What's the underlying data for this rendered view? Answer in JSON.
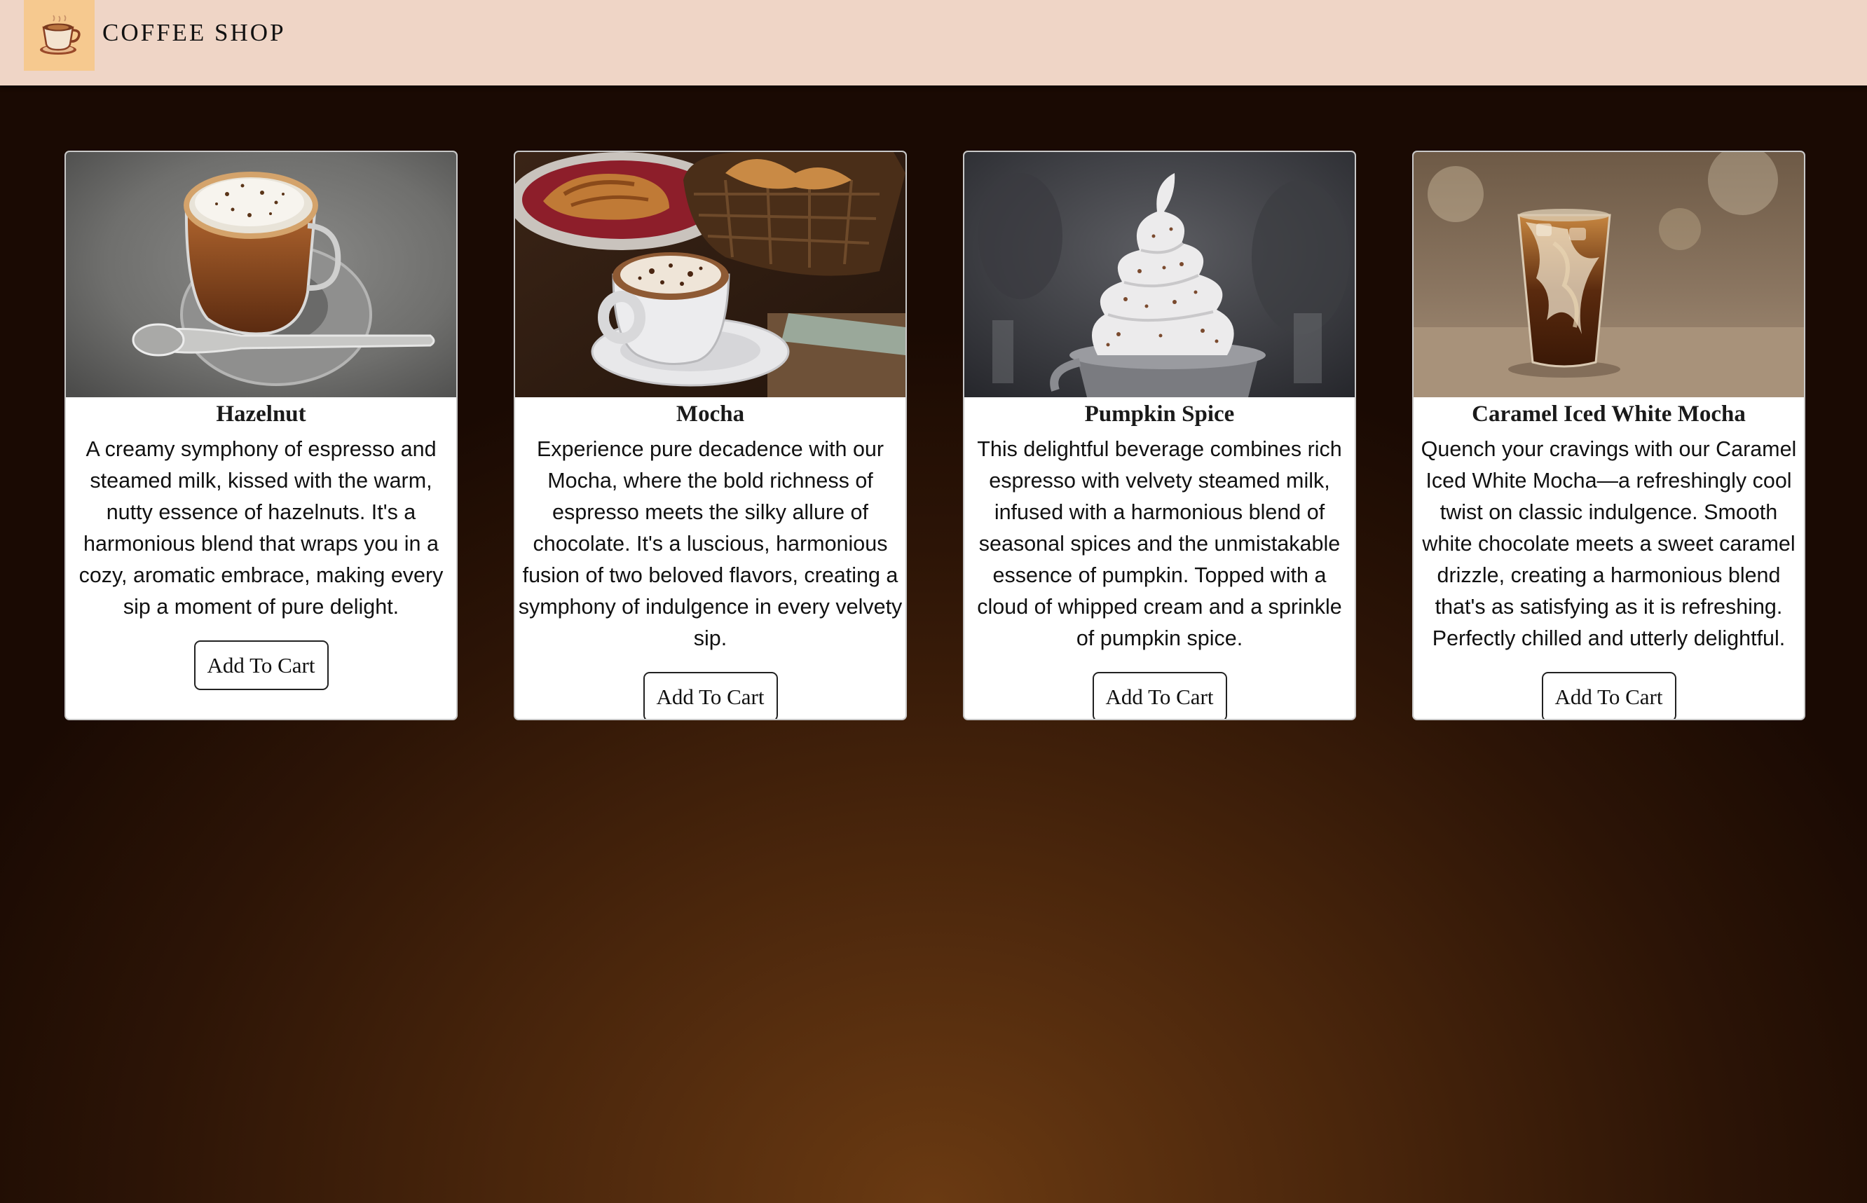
{
  "header": {
    "brand": "COFFEE SHOP",
    "logo_icon": "coffee-cup-icon",
    "background": "#efd5c6"
  },
  "products": [
    {
      "name": "Hazelnut",
      "description": "A creamy symphony of espresso and steamed milk, kissed with the warm, nutty essence of hazelnuts. It's a harmonious blend that wraps you in a cozy, aromatic embrace, making every sip a moment of pure delight.",
      "button_label": "Add To Cart",
      "image": "hazelnut-latte-photo"
    },
    {
      "name": "Mocha",
      "description": "Experience pure decadence with our Mocha, where the bold richness of espresso meets the silky allure of chocolate. It's a luscious, harmonious fusion of two beloved flavors, creating a symphony of indulgence in every velvety sip.",
      "button_label": "Add To Cart",
      "image": "mocha-with-croissants-photo"
    },
    {
      "name": "Pumpkin Spice",
      "description": "This delightful beverage combines rich espresso with velvety steamed milk, infused with a harmonious blend of seasonal spices and the unmistakable essence of pumpkin. Topped with a cloud of whipped cream and a sprinkle of pumpkin spice.",
      "button_label": "Add To Cart",
      "image": "pumpkin-spice-whipped-cream-photo"
    },
    {
      "name": "Caramel Iced White Mocha",
      "description": "Quench your cravings with our Caramel Iced White Mocha—a refreshingly cool twist on classic indulgence. Smooth white chocolate meets a sweet caramel drizzle, creating a harmonious blend that's as satisfying as it is refreshing. Perfectly chilled and utterly delightful.",
      "button_label": "Add To Cart",
      "image": "iced-caramel-mocha-glass-photo"
    }
  ]
}
